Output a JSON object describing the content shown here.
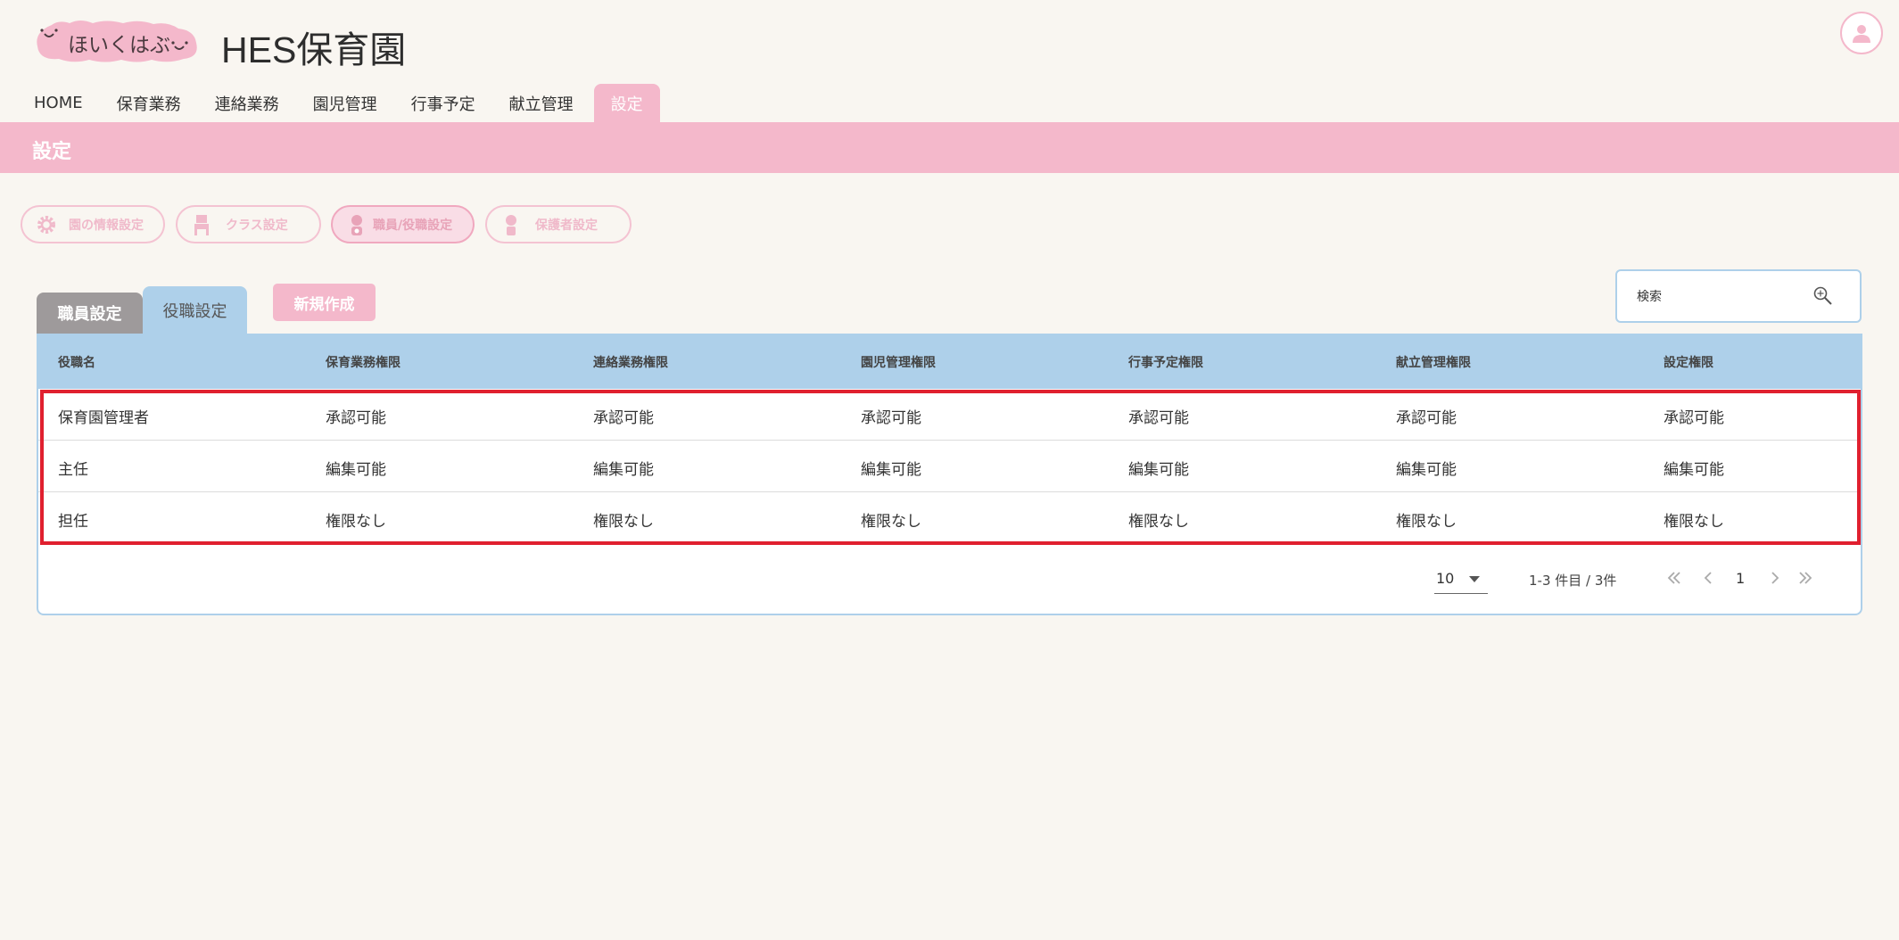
{
  "header": {
    "logo_text": "ほいくはぶ",
    "app_title": "HES保育園"
  },
  "nav": [
    {
      "label": "HOME"
    },
    {
      "label": "保育業務"
    },
    {
      "label": "連絡業務"
    },
    {
      "label": "園児管理"
    },
    {
      "label": "行事予定"
    },
    {
      "label": "献立管理"
    },
    {
      "label": "設定",
      "active": true
    }
  ],
  "banner": {
    "title": "設定"
  },
  "settings_menu": [
    {
      "label": "園の情報設定",
      "icon": "gear-icon"
    },
    {
      "label": "クラス設定",
      "icon": "class-icon"
    },
    {
      "label": "職員/役職設定",
      "icon": "staff-icon",
      "active": true
    },
    {
      "label": "保護者設定",
      "icon": "guardian-icon"
    }
  ],
  "tabs": {
    "staff": "職員設定",
    "role": "役職設定"
  },
  "new_button": "新規作成",
  "search": {
    "placeholder": "検索"
  },
  "table": {
    "headers": [
      "役職名",
      "保育業務権限",
      "連絡業務権限",
      "園児管理権限",
      "行事予定権限",
      "献立管理権限",
      "設定権限"
    ],
    "rows": [
      [
        "保育園管理者",
        "承認可能",
        "承認可能",
        "承認可能",
        "承認可能",
        "承認可能",
        "承認可能"
      ],
      [
        "主任",
        "編集可能",
        "編集可能",
        "編集可能",
        "編集可能",
        "編集可能",
        "編集可能"
      ],
      [
        "担任",
        "権限なし",
        "権限なし",
        "権限なし",
        "権限なし",
        "権限なし",
        "権限なし"
      ]
    ]
  },
  "pagination": {
    "per_page": "10",
    "range_text": "1-3 件目 / 3件",
    "current_page": "1"
  },
  "colors": {
    "accent_pink": "#f4b8cb",
    "accent_blue": "#aed0ea",
    "highlight_red": "#e0202f",
    "background": "#f9f6f1"
  }
}
